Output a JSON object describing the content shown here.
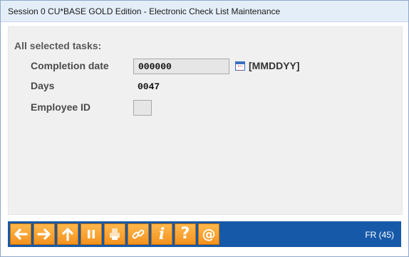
{
  "window": {
    "title": "Session 0 CU*BASE GOLD Edition - Electronic Check List Maintenance"
  },
  "form": {
    "section_label": "All selected tasks:",
    "completion_date": {
      "label": "Completion date",
      "value": "000000",
      "format_hint": "[MMDDYY]",
      "icon": "calendar-icon"
    },
    "days": {
      "label": "Days",
      "value": "0047"
    },
    "employee_id": {
      "label": "Employee ID",
      "value": ""
    }
  },
  "toolbar": {
    "buttons": [
      {
        "name": "back-button",
        "icon": "arrow-left-icon"
      },
      {
        "name": "forward-button",
        "icon": "arrow-right-icon"
      },
      {
        "name": "up-button",
        "icon": "arrow-up-icon"
      },
      {
        "name": "pause-button",
        "icon": "pause-icon"
      },
      {
        "name": "print-button",
        "icon": "printer-icon"
      },
      {
        "name": "link-button",
        "icon": "link-icon"
      },
      {
        "name": "info-button",
        "icon": "info-icon"
      },
      {
        "name": "help-button",
        "icon": "question-icon"
      },
      {
        "name": "email-button",
        "icon": "at-icon"
      }
    ],
    "status_code": "FR (45)"
  },
  "colors": {
    "toolbar_bg": "#1659a8",
    "button_orange": "#f7a33a",
    "titlebar_bg": "#e4eef9",
    "content_bg": "#f0f0f0"
  }
}
